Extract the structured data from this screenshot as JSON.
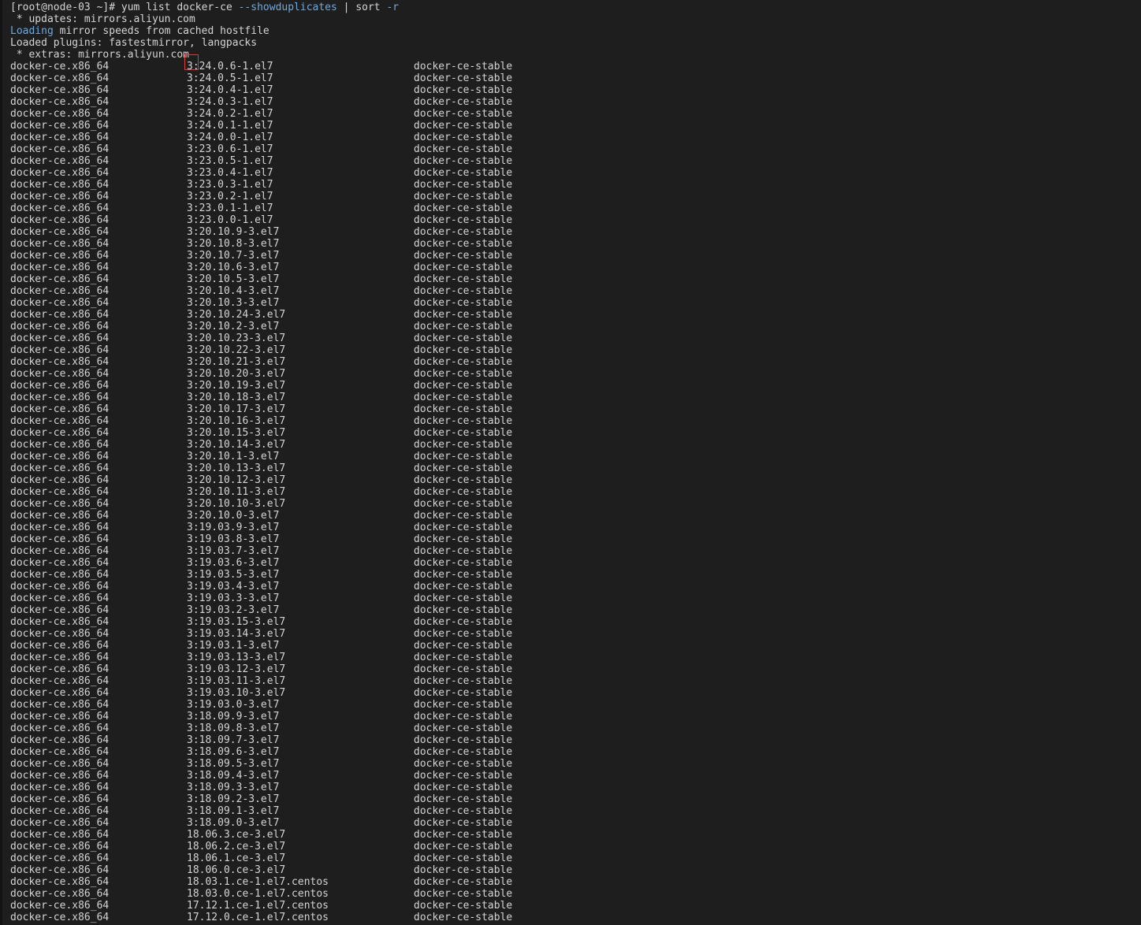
{
  "terminal": {
    "prompt": "[root@node-03 ~]# ",
    "command_main": "yum list docker-ce ",
    "command_flag": "--showduplicates",
    "command_pipe": " | sort ",
    "command_flag2": "-r",
    "header_lines": [
      {
        "prefix": " * updates: mirrors.aliyun.com",
        "highlight": "",
        "rest": ""
      },
      {
        "prefix": "",
        "highlight": "Loading",
        "rest": " mirror speeds from cached hostfile"
      },
      {
        "prefix": "Loaded plugins: fastestmirror, langpacks",
        "highlight": "",
        "rest": ""
      },
      {
        "prefix": " * extras: mirrors.aliyun.com",
        "highlight": "",
        "rest": ""
      }
    ],
    "highlight_color": "#6fa8dc",
    "annotation_color": "#e03a3a",
    "rows": [
      {
        "pkg": "docker-ce.x86_64",
        "ver": "3:24.0.6-1.el7",
        "repo": "docker-ce-stable",
        "marked": true
      },
      {
        "pkg": "docker-ce.x86_64",
        "ver": "3:24.0.5-1.el7",
        "repo": "docker-ce-stable"
      },
      {
        "pkg": "docker-ce.x86_64",
        "ver": "3:24.0.4-1.el7",
        "repo": "docker-ce-stable"
      },
      {
        "pkg": "docker-ce.x86_64",
        "ver": "3:24.0.3-1.el7",
        "repo": "docker-ce-stable"
      },
      {
        "pkg": "docker-ce.x86_64",
        "ver": "3:24.0.2-1.el7",
        "repo": "docker-ce-stable"
      },
      {
        "pkg": "docker-ce.x86_64",
        "ver": "3:24.0.1-1.el7",
        "repo": "docker-ce-stable"
      },
      {
        "pkg": "docker-ce.x86_64",
        "ver": "3:24.0.0-1.el7",
        "repo": "docker-ce-stable"
      },
      {
        "pkg": "docker-ce.x86_64",
        "ver": "3:23.0.6-1.el7",
        "repo": "docker-ce-stable"
      },
      {
        "pkg": "docker-ce.x86_64",
        "ver": "3:23.0.5-1.el7",
        "repo": "docker-ce-stable"
      },
      {
        "pkg": "docker-ce.x86_64",
        "ver": "3:23.0.4-1.el7",
        "repo": "docker-ce-stable"
      },
      {
        "pkg": "docker-ce.x86_64",
        "ver": "3:23.0.3-1.el7",
        "repo": "docker-ce-stable"
      },
      {
        "pkg": "docker-ce.x86_64",
        "ver": "3:23.0.2-1.el7",
        "repo": "docker-ce-stable"
      },
      {
        "pkg": "docker-ce.x86_64",
        "ver": "3:23.0.1-1.el7",
        "repo": "docker-ce-stable"
      },
      {
        "pkg": "docker-ce.x86_64",
        "ver": "3:23.0.0-1.el7",
        "repo": "docker-ce-stable"
      },
      {
        "pkg": "docker-ce.x86_64",
        "ver": "3:20.10.9-3.el7",
        "repo": "docker-ce-stable"
      },
      {
        "pkg": "docker-ce.x86_64",
        "ver": "3:20.10.8-3.el7",
        "repo": "docker-ce-stable"
      },
      {
        "pkg": "docker-ce.x86_64",
        "ver": "3:20.10.7-3.el7",
        "repo": "docker-ce-stable"
      },
      {
        "pkg": "docker-ce.x86_64",
        "ver": "3:20.10.6-3.el7",
        "repo": "docker-ce-stable"
      },
      {
        "pkg": "docker-ce.x86_64",
        "ver": "3:20.10.5-3.el7",
        "repo": "docker-ce-stable"
      },
      {
        "pkg": "docker-ce.x86_64",
        "ver": "3:20.10.4-3.el7",
        "repo": "docker-ce-stable"
      },
      {
        "pkg": "docker-ce.x86_64",
        "ver": "3:20.10.3-3.el7",
        "repo": "docker-ce-stable"
      },
      {
        "pkg": "docker-ce.x86_64",
        "ver": "3:20.10.24-3.el7",
        "repo": "docker-ce-stable"
      },
      {
        "pkg": "docker-ce.x86_64",
        "ver": "3:20.10.2-3.el7",
        "repo": "docker-ce-stable"
      },
      {
        "pkg": "docker-ce.x86_64",
        "ver": "3:20.10.23-3.el7",
        "repo": "docker-ce-stable"
      },
      {
        "pkg": "docker-ce.x86_64",
        "ver": "3:20.10.22-3.el7",
        "repo": "docker-ce-stable"
      },
      {
        "pkg": "docker-ce.x86_64",
        "ver": "3:20.10.21-3.el7",
        "repo": "docker-ce-stable"
      },
      {
        "pkg": "docker-ce.x86_64",
        "ver": "3:20.10.20-3.el7",
        "repo": "docker-ce-stable"
      },
      {
        "pkg": "docker-ce.x86_64",
        "ver": "3:20.10.19-3.el7",
        "repo": "docker-ce-stable"
      },
      {
        "pkg": "docker-ce.x86_64",
        "ver": "3:20.10.18-3.el7",
        "repo": "docker-ce-stable"
      },
      {
        "pkg": "docker-ce.x86_64",
        "ver": "3:20.10.17-3.el7",
        "repo": "docker-ce-stable"
      },
      {
        "pkg": "docker-ce.x86_64",
        "ver": "3:20.10.16-3.el7",
        "repo": "docker-ce-stable"
      },
      {
        "pkg": "docker-ce.x86_64",
        "ver": "3:20.10.15-3.el7",
        "repo": "docker-ce-stable"
      },
      {
        "pkg": "docker-ce.x86_64",
        "ver": "3:20.10.14-3.el7",
        "repo": "docker-ce-stable"
      },
      {
        "pkg": "docker-ce.x86_64",
        "ver": "3:20.10.1-3.el7",
        "repo": "docker-ce-stable"
      },
      {
        "pkg": "docker-ce.x86_64",
        "ver": "3:20.10.13-3.el7",
        "repo": "docker-ce-stable"
      },
      {
        "pkg": "docker-ce.x86_64",
        "ver": "3:20.10.12-3.el7",
        "repo": "docker-ce-stable"
      },
      {
        "pkg": "docker-ce.x86_64",
        "ver": "3:20.10.11-3.el7",
        "repo": "docker-ce-stable"
      },
      {
        "pkg": "docker-ce.x86_64",
        "ver": "3:20.10.10-3.el7",
        "repo": "docker-ce-stable"
      },
      {
        "pkg": "docker-ce.x86_64",
        "ver": "3:20.10.0-3.el7",
        "repo": "docker-ce-stable"
      },
      {
        "pkg": "docker-ce.x86_64",
        "ver": "3:19.03.9-3.el7",
        "repo": "docker-ce-stable"
      },
      {
        "pkg": "docker-ce.x86_64",
        "ver": "3:19.03.8-3.el7",
        "repo": "docker-ce-stable"
      },
      {
        "pkg": "docker-ce.x86_64",
        "ver": "3:19.03.7-3.el7",
        "repo": "docker-ce-stable"
      },
      {
        "pkg": "docker-ce.x86_64",
        "ver": "3:19.03.6-3.el7",
        "repo": "docker-ce-stable"
      },
      {
        "pkg": "docker-ce.x86_64",
        "ver": "3:19.03.5-3.el7",
        "repo": "docker-ce-stable"
      },
      {
        "pkg": "docker-ce.x86_64",
        "ver": "3:19.03.4-3.el7",
        "repo": "docker-ce-stable"
      },
      {
        "pkg": "docker-ce.x86_64",
        "ver": "3:19.03.3-3.el7",
        "repo": "docker-ce-stable"
      },
      {
        "pkg": "docker-ce.x86_64",
        "ver": "3:19.03.2-3.el7",
        "repo": "docker-ce-stable"
      },
      {
        "pkg": "docker-ce.x86_64",
        "ver": "3:19.03.15-3.el7",
        "repo": "docker-ce-stable"
      },
      {
        "pkg": "docker-ce.x86_64",
        "ver": "3:19.03.14-3.el7",
        "repo": "docker-ce-stable"
      },
      {
        "pkg": "docker-ce.x86_64",
        "ver": "3:19.03.1-3.el7",
        "repo": "docker-ce-stable"
      },
      {
        "pkg": "docker-ce.x86_64",
        "ver": "3:19.03.13-3.el7",
        "repo": "docker-ce-stable"
      },
      {
        "pkg": "docker-ce.x86_64",
        "ver": "3:19.03.12-3.el7",
        "repo": "docker-ce-stable"
      },
      {
        "pkg": "docker-ce.x86_64",
        "ver": "3:19.03.11-3.el7",
        "repo": "docker-ce-stable"
      },
      {
        "pkg": "docker-ce.x86_64",
        "ver": "3:19.03.10-3.el7",
        "repo": "docker-ce-stable"
      },
      {
        "pkg": "docker-ce.x86_64",
        "ver": "3:19.03.0-3.el7",
        "repo": "docker-ce-stable"
      },
      {
        "pkg": "docker-ce.x86_64",
        "ver": "3:18.09.9-3.el7",
        "repo": "docker-ce-stable"
      },
      {
        "pkg": "docker-ce.x86_64",
        "ver": "3:18.09.8-3.el7",
        "repo": "docker-ce-stable"
      },
      {
        "pkg": "docker-ce.x86_64",
        "ver": "3:18.09.7-3.el7",
        "repo": "docker-ce-stable"
      },
      {
        "pkg": "docker-ce.x86_64",
        "ver": "3:18.09.6-3.el7",
        "repo": "docker-ce-stable"
      },
      {
        "pkg": "docker-ce.x86_64",
        "ver": "3:18.09.5-3.el7",
        "repo": "docker-ce-stable"
      },
      {
        "pkg": "docker-ce.x86_64",
        "ver": "3:18.09.4-3.el7",
        "repo": "docker-ce-stable"
      },
      {
        "pkg": "docker-ce.x86_64",
        "ver": "3:18.09.3-3.el7",
        "repo": "docker-ce-stable"
      },
      {
        "pkg": "docker-ce.x86_64",
        "ver": "3:18.09.2-3.el7",
        "repo": "docker-ce-stable"
      },
      {
        "pkg": "docker-ce.x86_64",
        "ver": "3:18.09.1-3.el7",
        "repo": "docker-ce-stable"
      },
      {
        "pkg": "docker-ce.x86_64",
        "ver": "3:18.09.0-3.el7",
        "repo": "docker-ce-stable"
      },
      {
        "pkg": "docker-ce.x86_64",
        "ver": "18.06.3.ce-3.el7",
        "repo": "docker-ce-stable"
      },
      {
        "pkg": "docker-ce.x86_64",
        "ver": "18.06.2.ce-3.el7",
        "repo": "docker-ce-stable"
      },
      {
        "pkg": "docker-ce.x86_64",
        "ver": "18.06.1.ce-3.el7",
        "repo": "docker-ce-stable"
      },
      {
        "pkg": "docker-ce.x86_64",
        "ver": "18.06.0.ce-3.el7",
        "repo": "docker-ce-stable"
      },
      {
        "pkg": "docker-ce.x86_64",
        "ver": "18.03.1.ce-1.el7.centos",
        "repo": "docker-ce-stable"
      },
      {
        "pkg": "docker-ce.x86_64",
        "ver": "18.03.0.ce-1.el7.centos",
        "repo": "docker-ce-stable"
      },
      {
        "pkg": "docker-ce.x86_64",
        "ver": "17.12.1.ce-1.el7.centos",
        "repo": "docker-ce-stable"
      },
      {
        "pkg": "docker-ce.x86_64",
        "ver": "17.12.0.ce-1.el7.centos",
        "repo": "docker-ce-stable"
      }
    ]
  }
}
